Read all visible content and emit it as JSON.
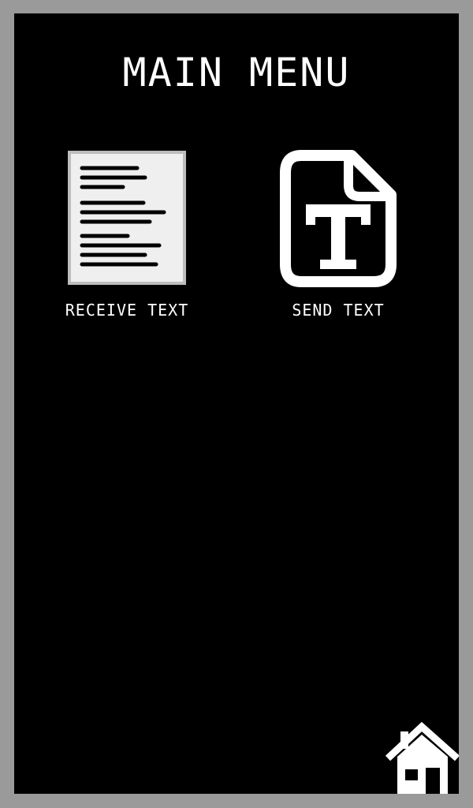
{
  "screen": {
    "title": "MAIN MENU"
  },
  "menu": {
    "items": [
      {
        "label": "RECEIVE TEXT",
        "icon": "document-lines-icon"
      },
      {
        "label": "SEND TEXT",
        "icon": "text-file-icon"
      }
    ]
  },
  "nav": {
    "home_icon": "home-icon"
  },
  "colors": {
    "frame": "#9a9a9a",
    "background": "#000000",
    "foreground": "#ffffff",
    "doc_paper": "#efefef"
  }
}
